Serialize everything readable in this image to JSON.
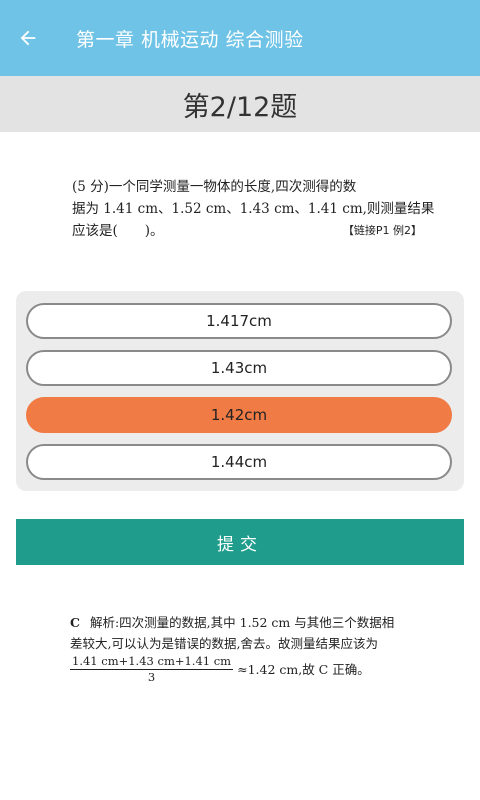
{
  "appbar": {
    "title": "第一章 机械运动 综合测验",
    "back_icon": "arrow-left-icon"
  },
  "question_counter": "第2/12题",
  "question": {
    "line1": "(5 分)一个同学测量一物体的长度,四次测得的数",
    "line2": "据为 1.41 cm、1.52 cm、1.43 cm、1.41 cm,则测量结果",
    "line3": "应该是(　　)。",
    "link_tag": "【链接P1 例2】"
  },
  "options": [
    {
      "label": "1.417cm",
      "selected": false
    },
    {
      "label": "1.43cm",
      "selected": false
    },
    {
      "label": "1.42cm",
      "selected": true
    },
    {
      "label": "1.44cm",
      "selected": false
    }
  ],
  "submit_label": "提交",
  "analysis": {
    "answer": "C",
    "line1": "解析:四次测量的数据,其中 1.52 cm 与其他三个数据相",
    "line2": "差较大,可以认为是错误的数据,舍去。故测量结果应该为",
    "frac_num": "1.41 cm+1.43 cm+1.41 cm",
    "frac_den": "3",
    "line3_tail": "≈1.42 cm,故 C 正确。"
  },
  "colors": {
    "appbar": "#6fc3e6",
    "selected_option": "#f07b45",
    "submit": "#1f9c8c"
  }
}
